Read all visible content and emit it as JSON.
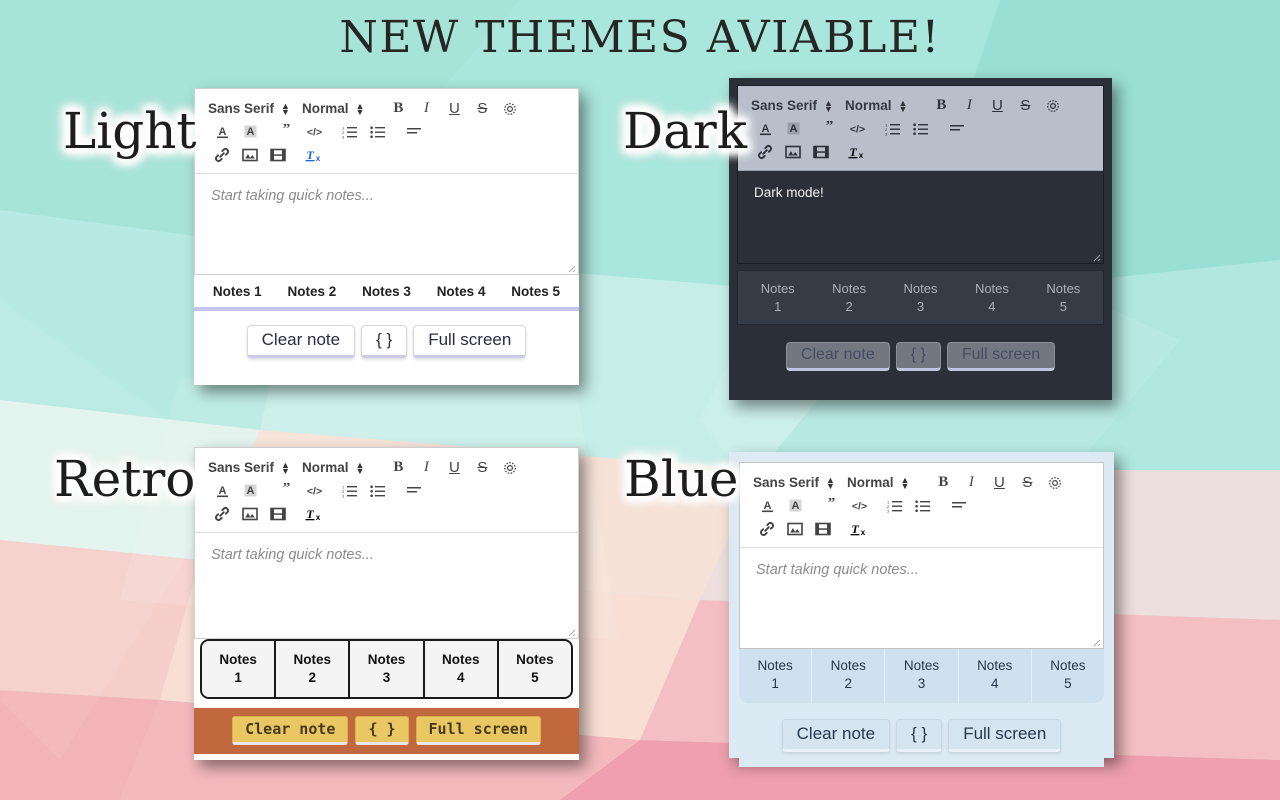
{
  "title": "NEW THEMES AVIABLE!",
  "toolbar": {
    "font_family_value": "Sans Serif",
    "font_size_value": "Normal",
    "buttons": {
      "bold": "B",
      "italic": "I",
      "underline": "U",
      "strike": "S"
    },
    "icon_names": [
      "gear-icon",
      "font-color-icon",
      "highlight-color-icon",
      "blockquote-icon",
      "code-block-icon",
      "ordered-list-icon",
      "bullet-list-icon",
      "align-icon",
      "link-icon",
      "image-icon",
      "video-icon",
      "clear-format-icon"
    ]
  },
  "editor": {
    "placeholder": "Start taking quick notes...",
    "dark_note_text": "Dark mode!"
  },
  "tabs": [
    {
      "word": "Notes",
      "num": "1",
      "full": "Notes 1"
    },
    {
      "word": "Notes",
      "num": "2",
      "full": "Notes 2"
    },
    {
      "word": "Notes",
      "num": "3",
      "full": "Notes 3"
    },
    {
      "word": "Notes",
      "num": "4",
      "full": "Notes 4"
    },
    {
      "word": "Notes",
      "num": "5",
      "full": "Notes 5"
    }
  ],
  "actions": {
    "clear_note": "Clear note",
    "braces": "{ }",
    "full_screen": "Full screen"
  },
  "themes": {
    "light": {
      "label": "Light",
      "accent": "#c5c4ee",
      "panel_bg": "#ffffff",
      "toolbar_bg": "#ffffff",
      "editor_bg": "#ffffff"
    },
    "dark": {
      "label": "Dark",
      "accent": "#bfc4e0",
      "panel_bg": "#2b3038",
      "toolbar_bg": "#b8bfcb",
      "editor_bg": "#2b3038",
      "tabs_bg": "#363c45",
      "button_bg": "#737880"
    },
    "retro": {
      "label": "Retro",
      "accent": "#c1683f",
      "panel_bg": "#ffffff",
      "toolbar_bg": "#ffffff",
      "editor_bg": "#ffffff",
      "button_bg": "#e9c863"
    },
    "blue": {
      "label": "Blue",
      "accent": "#cfe0ee",
      "panel_bg": "#dceaf4",
      "toolbar_bg": "#ffffff",
      "editor_bg": "#ffffff",
      "button_bg": "#d5e5f0"
    }
  },
  "background": {
    "style": "low-poly-gradient",
    "colors": [
      "#9fe2d6",
      "#b8ece6",
      "#d8f2ec",
      "#f7e0d6",
      "#f6c8c2",
      "#f2a9b2",
      "#ef9fae"
    ]
  }
}
